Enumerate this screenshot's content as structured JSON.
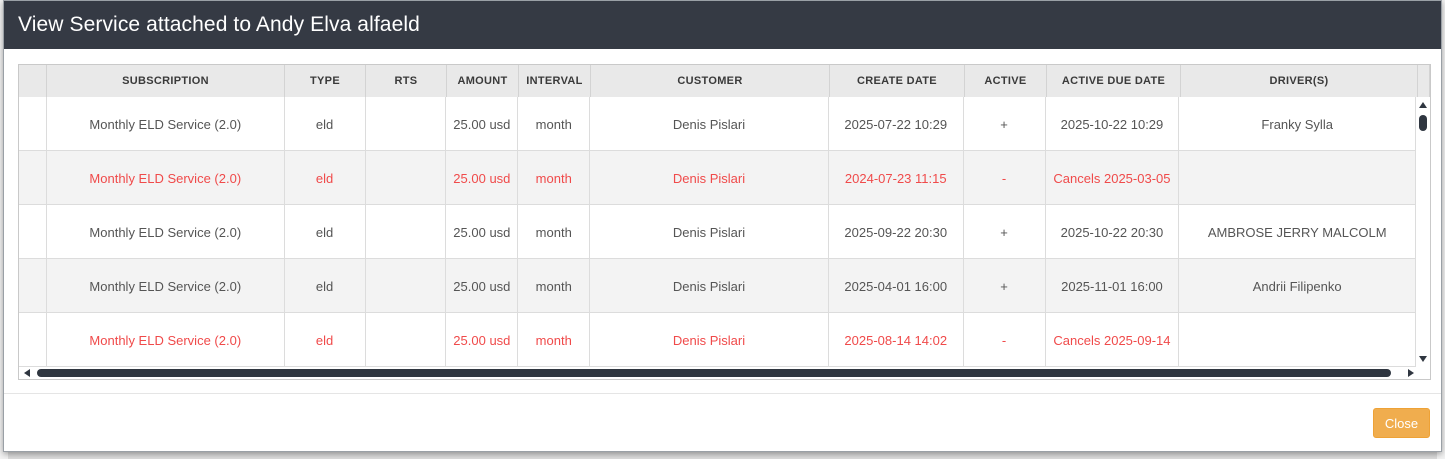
{
  "modal": {
    "title": "View Service attached to Andy Elva alfaeld",
    "close_label": "Close"
  },
  "table": {
    "headers": [
      "",
      "SUBSCRIPTION",
      "TYPE",
      "RTS",
      "AMOUNT",
      "INTERVAL",
      "CUSTOMER",
      "CREATE DATE",
      "ACTIVE",
      "ACTIVE DUE DATE",
      "DRIVER(S)",
      ""
    ],
    "rows": [
      {
        "cancelled": false,
        "cells": [
          "",
          "Monthly ELD Service (2.0)",
          "eld",
          "",
          "25.00 usd",
          "month",
          "Denis Pislari",
          "2025-07-22 10:29",
          "+",
          "2025-10-22 10:29",
          "Franky Sylla"
        ]
      },
      {
        "cancelled": true,
        "cells": [
          "",
          "Monthly ELD Service (2.0)",
          "eld",
          "",
          "25.00 usd",
          "month",
          "Denis Pislari",
          "2024-07-23 11:15",
          "-",
          "Cancels 2025-03-05",
          ""
        ]
      },
      {
        "cancelled": false,
        "cells": [
          "",
          "Monthly ELD Service (2.0)",
          "eld",
          "",
          "25.00 usd",
          "month",
          "Denis Pislari",
          "2025-09-22 20:30",
          "+",
          "2025-10-22 20:30",
          "AMBROSE JERRY MALCOLM"
        ]
      },
      {
        "cancelled": false,
        "cells": [
          "",
          "Monthly ELD Service (2.0)",
          "eld",
          "",
          "25.00 usd",
          "month",
          "Denis Pislari",
          "2025-04-01 16:00",
          "+",
          "2025-11-01 16:00",
          "Andrii Filipenko"
        ]
      },
      {
        "cancelled": true,
        "cells": [
          "",
          "Monthly ELD Service (2.0)",
          "eld",
          "",
          "25.00 usd",
          "month",
          "Denis Pislari",
          "2025-08-14 14:02",
          "-",
          "Cancels 2025-09-14",
          ""
        ]
      }
    ]
  },
  "colors": {
    "header_bg": "#353a44",
    "cancelled_text": "#f04a4a",
    "close_button": "#f0ad4e"
  }
}
